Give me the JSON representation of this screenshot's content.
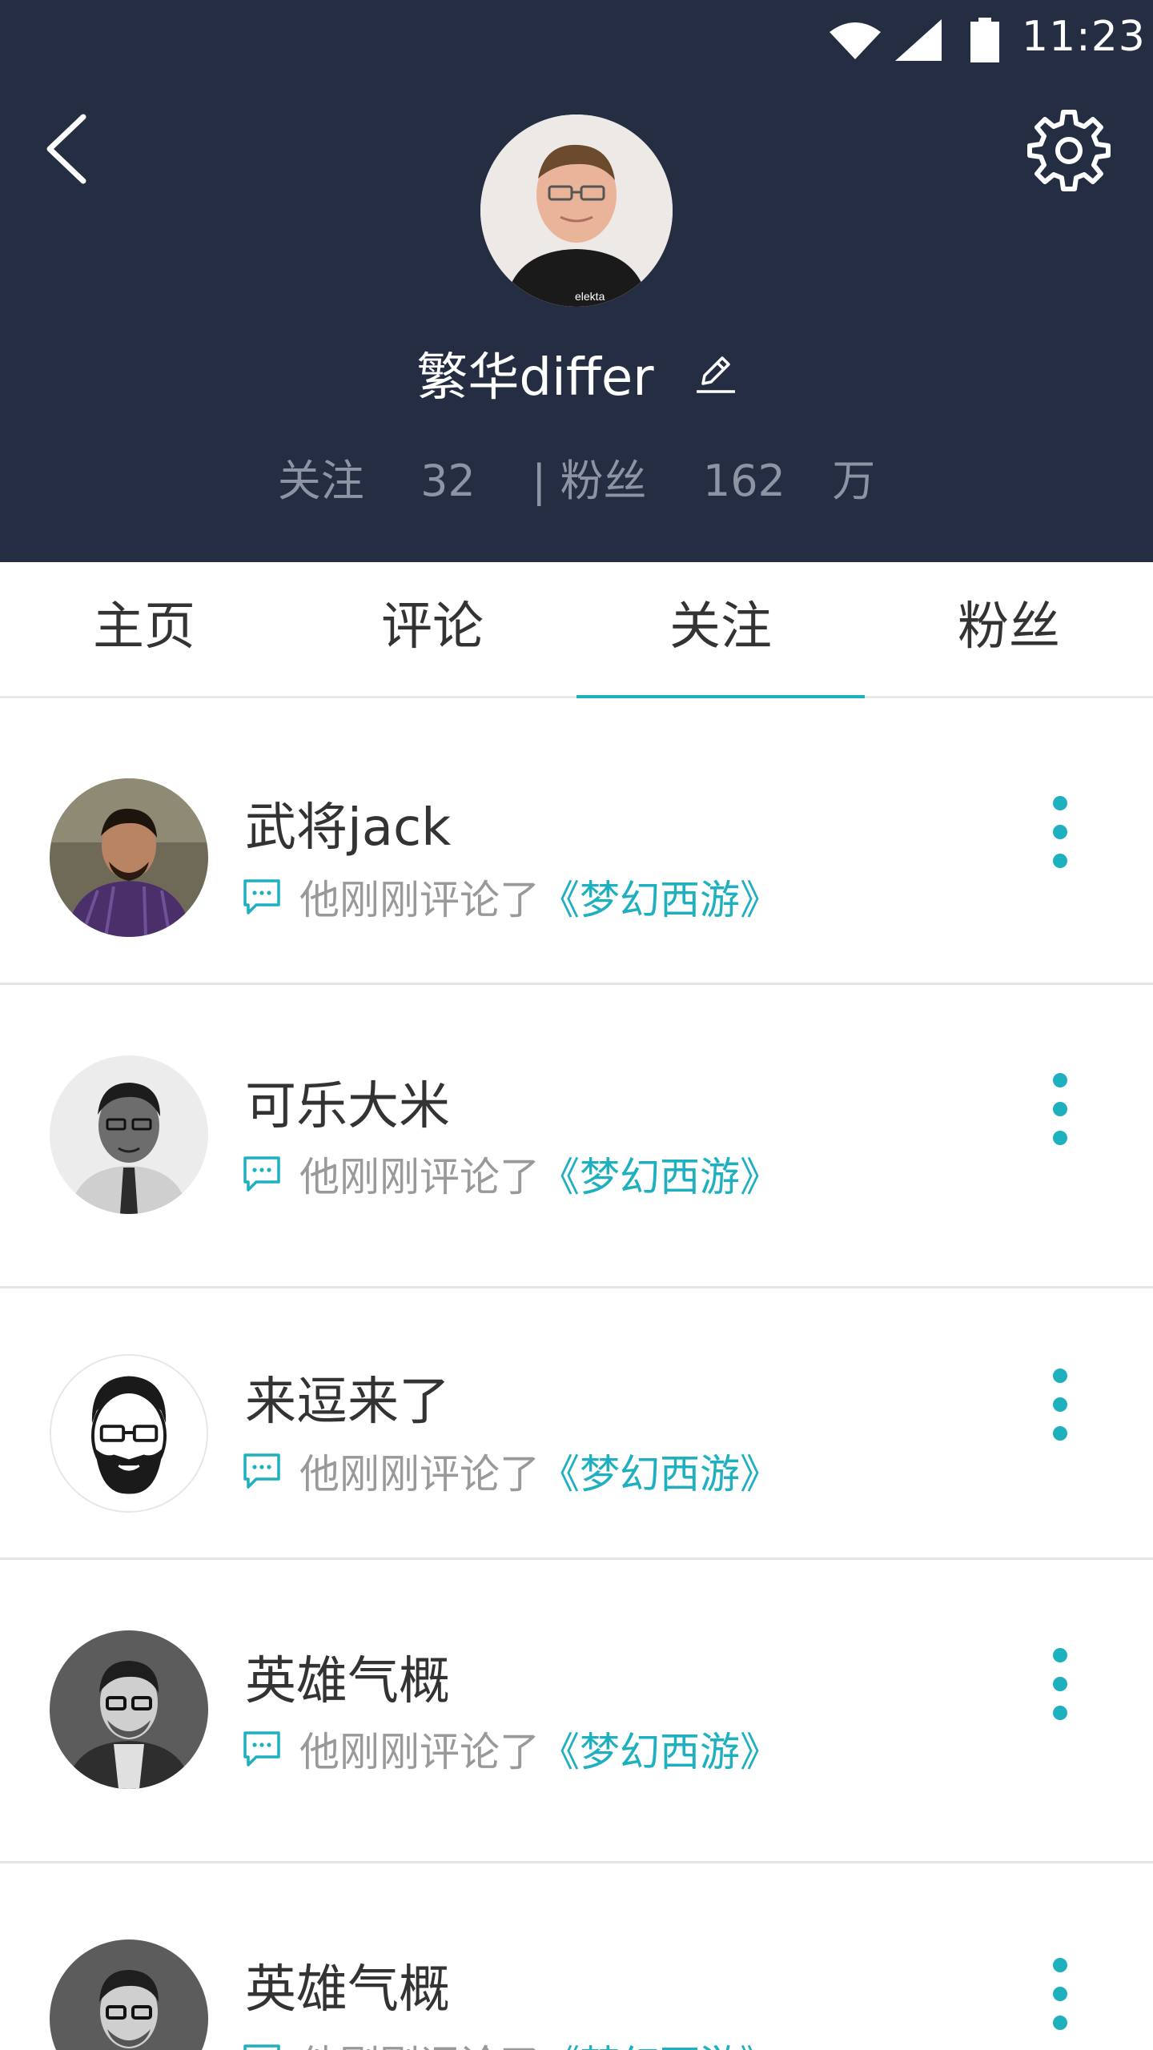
{
  "status_bar": {
    "time": "11:23"
  },
  "profile": {
    "name": "繁华differ",
    "following_label": "关注",
    "following_count": "32",
    "separator": "|",
    "followers_label": "粉丝",
    "followers_count": "162",
    "followers_unit": "万"
  },
  "tabs": [
    {
      "label": "主页",
      "active": false
    },
    {
      "label": "评论",
      "active": false
    },
    {
      "label": "关注",
      "active": true
    },
    {
      "label": "粉丝",
      "active": false
    }
  ],
  "following_list": [
    {
      "name": "武将jack",
      "activity": "他刚刚评论了",
      "link": "《梦幻西游》"
    },
    {
      "name": "可乐大米",
      "activity": "他刚刚评论了",
      "link": "《梦幻西游》"
    },
    {
      "name": "来逗来了",
      "activity": "他刚刚评论了",
      "link": "《梦幻西游》"
    },
    {
      "name": "英雄气概",
      "activity": "他刚刚评论了",
      "link": "《梦幻西游》"
    },
    {
      "name": "英雄气概",
      "activity": "他刚刚评论了",
      "link": "《梦幻西游》"
    }
  ],
  "colors": {
    "header_bg": "#242d42",
    "accent": "#1fb0bf",
    "stat_text": "#8d94a4"
  },
  "icons": [
    "wifi-icon",
    "signal-icon",
    "battery-icon",
    "back-arrow-icon",
    "gear-icon",
    "pencil-icon",
    "comment-icon",
    "more-vertical-icon"
  ]
}
